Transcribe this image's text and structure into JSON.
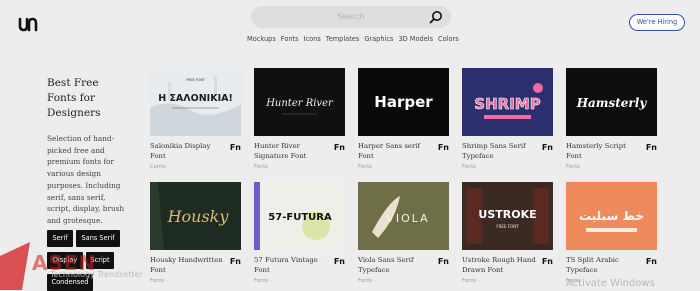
{
  "header": {
    "logo_text": "un",
    "search_placeholder": "Search",
    "nav": [
      "Mockups",
      "Fonts",
      "Icons",
      "Templates",
      "Graphics",
      "3D Models",
      "Colors"
    ],
    "hiring_label": "We're Hiring"
  },
  "sidebar": {
    "title": "Best Free Fonts for Designers",
    "description": "Selection of hand-picked free and premium fonts for various design purposes. Including serif, sans serif, script, display, brush and grotesque.",
    "tags": [
      "Serif",
      "Sans Serif",
      "Display",
      "Script",
      "Condensed"
    ]
  },
  "cards": [
    {
      "title": "Salonikia Display Font",
      "badge": "Fn",
      "category": "Comic",
      "preview_text": "Η ΣΑΛΟΝΙΚΙΑ!",
      "preview_small": "FREE FONT",
      "bg": "#e8ecef"
    },
    {
      "title": "Hunter River Signature Font",
      "badge": "Fn",
      "category": "Fonts",
      "preview_text": "Hunter River",
      "bg": "#101010"
    },
    {
      "title": "Harper Sans serif Font",
      "badge": "Fn",
      "category": "Fonts",
      "preview_text": "Harper",
      "bg": "#0a0a0a"
    },
    {
      "title": "Shrimp Sans Serif Typeface",
      "badge": "Fn",
      "category": "Fonts",
      "preview_text": "SHRIMP",
      "bg": "#2b2f6e"
    },
    {
      "title": "Hamsterly Script Font",
      "badge": "Fn",
      "category": "Fonts",
      "preview_text": "Hamsterly",
      "bg": "#0d0d0d"
    },
    {
      "title": "Housky Handwritten Font",
      "badge": "Fn",
      "category": "Fonts",
      "preview_text": "Housky",
      "bg": "#1e2b22"
    },
    {
      "title": "57 Futura Vintage Font",
      "badge": "Fn",
      "category": "Fonts",
      "preview_text": "57-FUTURA",
      "bg": "#efefe9"
    },
    {
      "title": "Viola Sans Serif Typeface",
      "badge": "Fn",
      "category": "Fonts",
      "preview_text": "VIOLA",
      "bg": "#6f6f47"
    },
    {
      "title": "Ustroke Rough Hand Drawn Font",
      "badge": "Fn",
      "category": "Fonts",
      "preview_text": "USTROKE",
      "preview_small": "FREE FONT",
      "bg": "#3a2a22"
    },
    {
      "title": "TS Split Arabic Typeface",
      "badge": "Fn",
      "category": "Fonts",
      "preview_text": "خط سبليت",
      "bg": "#ee8a5c"
    }
  ],
  "overlays": {
    "watermark_text": "Technology Trendsetter",
    "os_notice": "Activate Windows"
  }
}
